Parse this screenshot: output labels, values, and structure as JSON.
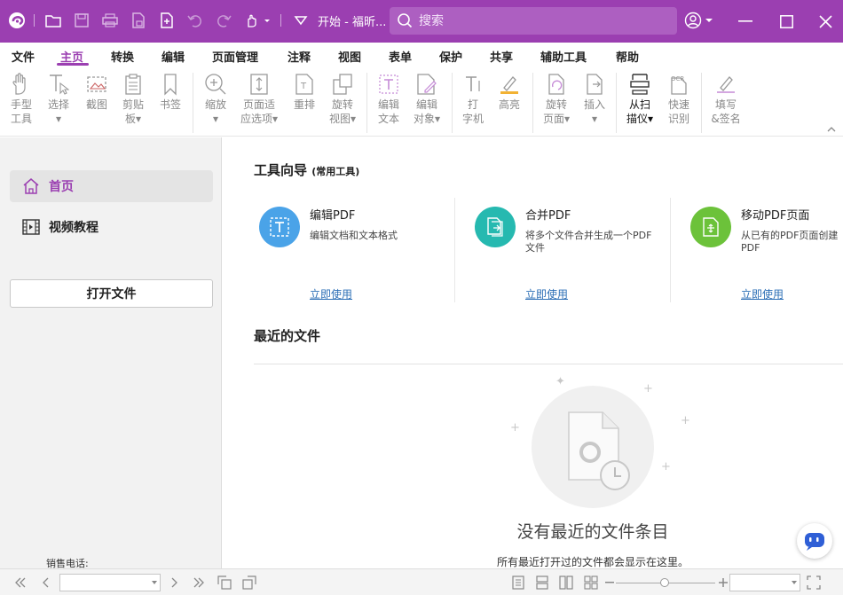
{
  "titlebar": {
    "doc_title": "开始 - 福昕...",
    "search_placeholder": "搜索",
    "accent_color": "#9b3fb1"
  },
  "menu": {
    "items": [
      "文件",
      "主页",
      "转换",
      "编辑",
      "页面管理",
      "注释",
      "视图",
      "表单",
      "保护",
      "共享",
      "辅助工具",
      "帮助"
    ],
    "active": "主页"
  },
  "ribbon": {
    "buttons": [
      {
        "l1": "手型",
        "l2": "工具",
        "icon": "hand-icon"
      },
      {
        "l1": "选择",
        "l2": "▾",
        "icon": "select-text-icon"
      },
      {
        "l1": "截图",
        "l2": "",
        "icon": "snapshot-icon"
      },
      {
        "l1": "剪贴",
        "l2": "板▾",
        "icon": "clipboard-icon"
      },
      {
        "l1": "书签",
        "l2": "",
        "icon": "bookmark-icon"
      },
      {
        "l1": "缩放",
        "l2": "▾",
        "icon": "zoom-icon"
      },
      {
        "l1": "页面适",
        "l2": "应选项▾",
        "icon": "fit-page-icon"
      },
      {
        "l1": "重排",
        "l2": "",
        "icon": "reflow-icon"
      },
      {
        "l1": "旋转",
        "l2": "视图▾",
        "icon": "rotate-view-icon"
      },
      {
        "l1": "编辑",
        "l2": "文本",
        "icon": "edit-text-icon"
      },
      {
        "l1": "编辑",
        "l2": "对象▾",
        "icon": "edit-object-icon"
      },
      {
        "l1": "打",
        "l2": "字机",
        "icon": "typewriter-icon"
      },
      {
        "l1": "高亮",
        "l2": "",
        "icon": "highlight-icon"
      },
      {
        "l1": "旋转",
        "l2": "页面▾",
        "icon": "rotate-page-icon"
      },
      {
        "l1": "插入",
        "l2": "▾",
        "icon": "insert-icon"
      },
      {
        "l1": "从扫",
        "l2": "描仪▾",
        "icon": "scanner-icon"
      },
      {
        "l1": "快速",
        "l2": "识别",
        "icon": "ocr-icon"
      },
      {
        "l1": "填写",
        "l2": "&签名",
        "icon": "fill-sign-icon"
      }
    ]
  },
  "sidebar": {
    "nav": [
      {
        "label": "首页",
        "icon": "home-icon"
      },
      {
        "label": "视频教程",
        "icon": "video-icon"
      }
    ],
    "open_file": "打开文件",
    "sales_phone": "销售电话:"
  },
  "main": {
    "tools_title": "工具向导",
    "tools_subtitle": "(常用工具)",
    "cards": [
      {
        "title": "编辑PDF",
        "desc": "编辑文档和文本格式",
        "link": "立即使用",
        "color": "#4aa3e8",
        "icon": "edit-pdf-icon"
      },
      {
        "title": "合并PDF",
        "desc": "将多个文件合并生成一个PDF文件",
        "link": "立即使用",
        "color": "#26b9b0",
        "icon": "merge-pdf-icon"
      },
      {
        "title": "移动PDF页面",
        "desc": "从已有的PDF页面创建PDF",
        "link": "立即使用",
        "color": "#6cc23a",
        "icon": "move-pages-icon"
      }
    ],
    "recent_title": "最近的文件",
    "empty_title": "没有最近的文件条目",
    "empty_desc": "所有最近打开过的文件都会显示在这里。"
  }
}
